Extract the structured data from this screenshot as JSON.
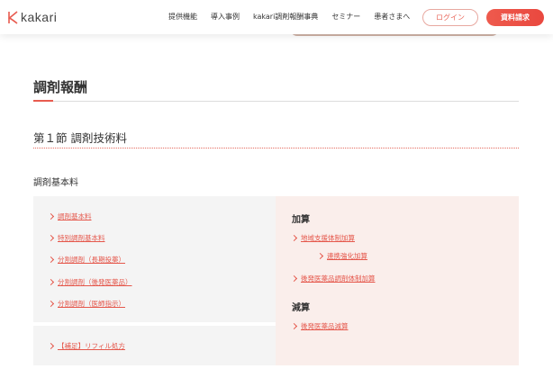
{
  "header": {
    "logo_text": "kakari",
    "nav": [
      "提供機能",
      "導入事例",
      "kakari調剤報酬事典",
      "セミナー",
      "患者さまへ"
    ],
    "login_label": "ログイン",
    "docs_label": "資料請求"
  },
  "page": {
    "title": "調剤報酬",
    "section_title": "第１節 調剤技術料",
    "sub_title": "調剤基本料"
  },
  "left_links": [
    "調剤基本料",
    "特別調剤基本料",
    "分割調剤（長期投薬）",
    "分割調剤（後発医薬品）",
    "分割調剤（医師指示）"
  ],
  "left_bottom_link": "【補足】リフィル処方",
  "right": {
    "kasan_head": "加算",
    "kasan_links": [
      "地域支援体制加算",
      "連携強化加算",
      "後発医薬品調剤体制加算"
    ],
    "gensan_head": "減算",
    "gensan_links": [
      "後発医薬品減算"
    ]
  },
  "colors": {
    "accent": "#e85b4f",
    "panel_left": "#f4f4f4",
    "panel_right": "#faeeeb"
  }
}
